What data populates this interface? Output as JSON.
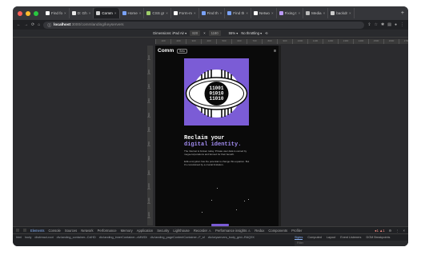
{
  "tabs": [
    {
      "label": "Find fo",
      "color": "#ffffff"
    },
    {
      "label": "D: Gh",
      "color": "#e8e8e8"
    },
    {
      "label": "Comm",
      "color": "#d0d0d0",
      "active": true
    },
    {
      "label": "Home",
      "color": "#7aa2f7"
    },
    {
      "label": "CSS gr",
      "color": "#9ece6a"
    },
    {
      "label": "Form-m",
      "color": "#ffffff"
    },
    {
      "label": "Find th",
      "color": "#7aa2f7"
    },
    {
      "label": "Find th",
      "color": "#7aa2f7"
    },
    {
      "label": "Netwo",
      "color": "#ffffff"
    },
    {
      "label": "Fixing t",
      "color": "#bb9af7"
    },
    {
      "label": "Media",
      "color": "#bbbbbb"
    },
    {
      "label": "backdr",
      "color": "#cccccc"
    }
  ],
  "address": {
    "host": "localhost",
    "port_path": ":3000/commlanding/keyservers"
  },
  "device_toolbar": {
    "dimensions": "Dimensions: iPad Air ▾",
    "width": "820",
    "x": "×",
    "height": "1180",
    "zoom": "55% ▾",
    "throttle": "No throttling ▾"
  },
  "ruler_h": [
    "100",
    "200",
    "300",
    "400",
    "500",
    "600",
    "700",
    "800",
    "900",
    "1000",
    "1100",
    "1200",
    "1300",
    "1400",
    "1500",
    "1600",
    "1700"
  ],
  "ruler_v": [
    "100",
    "200",
    "300",
    "400",
    "500",
    "600",
    "700",
    "800",
    "900",
    "1000",
    "1100",
    "1200"
  ],
  "app": {
    "logo": "Comm",
    "beta": "Beta",
    "heading_line1": "Reclaim your",
    "heading_line2": "digital identity.",
    "para1": "The Internet is broken today. Private user data is owned by mega-corporations and farmed for their benefit.",
    "para2": "E2E encryption has the potential to change this equation. But it's constrained by a crucial limitation.",
    "binary": [
      "11001",
      "01010",
      "11010"
    ]
  },
  "devtools": {
    "tabs": [
      "Elements",
      "Console",
      "Sources",
      "Network",
      "Performance",
      "Memory",
      "Application",
      "Security",
      "Lighthouse",
      "Recorder ⚠",
      "Performance insights ⚠",
      "Redux",
      "Components",
      "Profiler"
    ],
    "crumbs": [
      "html",
      "body",
      "div#react-root",
      "div.landing_container--CxiHD",
      "div.landing_innerContainer--vMWDt",
      "div.landing_pageContentContainer--F_sf",
      "div.keyservers_body_grid--RAQ9X"
    ],
    "side_tabs": [
      "Styles",
      "Computed",
      "Layout",
      "Event Listeners",
      "DOM Breakpoints"
    ],
    "filter": "Filter",
    "badges": "●1 ▲1"
  },
  "colors": {
    "accent": "#7b5cd6",
    "accent_text": "#a18bf0",
    "devtools_active": "#8ab4f8"
  }
}
